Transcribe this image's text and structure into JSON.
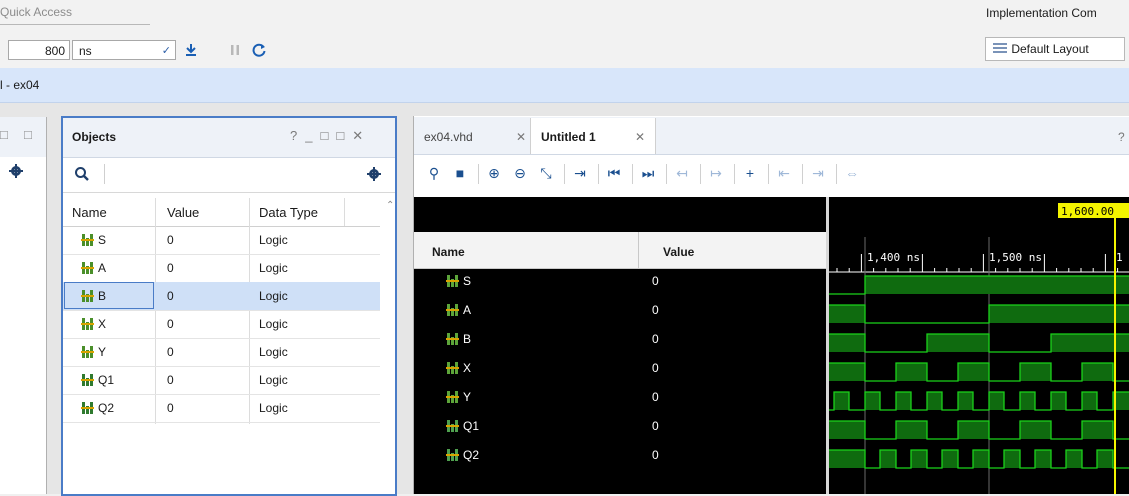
{
  "top": {
    "quick_access_placeholder": "Quick Access",
    "implementation_status": "Implementation Com"
  },
  "toolbar": {
    "run_time_value": "800",
    "run_time_unit": "ns",
    "layout_label": "Default Layout"
  },
  "breadcrumb": {
    "text": "l - ex04"
  },
  "objects": {
    "title": "Objects",
    "columns": [
      "Name",
      "Value",
      "Data Type"
    ],
    "rows": [
      {
        "name": "S",
        "value": "0",
        "type": "Logic"
      },
      {
        "name": "A",
        "value": "0",
        "type": "Logic"
      },
      {
        "name": "B",
        "value": "0",
        "type": "Logic"
      },
      {
        "name": "X",
        "value": "0",
        "type": "Logic"
      },
      {
        "name": "Y",
        "value": "0",
        "type": "Logic"
      },
      {
        "name": "Q1",
        "value": "0",
        "type": "Logic"
      },
      {
        "name": "Q2",
        "value": "0",
        "type": "Logic"
      }
    ],
    "selected_row": "B"
  },
  "waveform": {
    "tabs": [
      {
        "label": "ex04.vhd",
        "active": false
      },
      {
        "label": "Untitled 1",
        "active": true
      }
    ],
    "help_label": "?",
    "name_header": "Name",
    "value_header": "Value",
    "cursor_label": "1,600.00",
    "ruler_labels": [
      "1,400 ns",
      "1,500 ns",
      "1"
    ],
    "signals": [
      {
        "name": "S",
        "value": "0"
      },
      {
        "name": "A",
        "value": "0"
      },
      {
        "name": "B",
        "value": "0"
      },
      {
        "name": "X",
        "value": "0"
      },
      {
        "name": "Y",
        "value": "0"
      },
      {
        "name": "Q1",
        "value": "0"
      },
      {
        "name": "Q2",
        "value": "0"
      }
    ]
  },
  "colors": {
    "wave_green": "#1bd21b",
    "wave_fill": "#0f6b0f",
    "cursor_yellow": "#f4f400",
    "accent_blue": "#4a7cc7"
  }
}
